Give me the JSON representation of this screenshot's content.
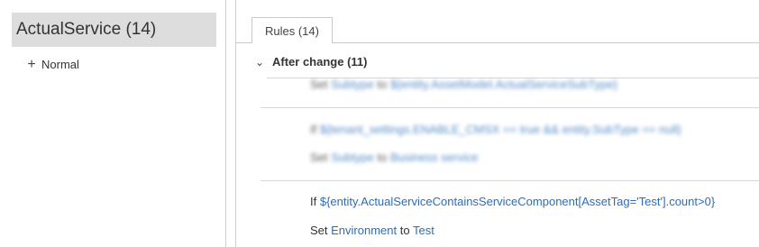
{
  "left": {
    "header_title": "ActualService (14)",
    "tree": [
      {
        "expander": "+",
        "label": "Normal"
      }
    ]
  },
  "right": {
    "tab_label": "Rules (14)",
    "section": {
      "chevron": "⌄",
      "title": "After change (11)"
    },
    "rules": [
      {
        "blurred": true,
        "lines": [
          {
            "keyword": "Set",
            "field": "Subtype",
            "connector": "to",
            "value": "${entity.AssetModel.ActualServiceSubType}"
          }
        ]
      },
      {
        "blurred": true,
        "lines": [
          {
            "keyword": "If",
            "expression": "${tenant_settings.ENABLE_CMSX == true && entity.SubType == null}"
          },
          {
            "keyword": "Set",
            "field": "Subtype",
            "connector": "to",
            "value": "Business service"
          }
        ]
      },
      {
        "blurred": false,
        "lines": [
          {
            "keyword": "If",
            "expression": "${entity.ActualServiceContainsServiceComponent[AssetTag='Test'].count>0}"
          },
          {
            "keyword": "Set",
            "field": "Environment",
            "connector": "to",
            "value": "Test"
          }
        ]
      }
    ]
  },
  "colors": {
    "link": "#2a6ebb",
    "header_bg": "#dddddd",
    "border": "#d0d0d0"
  }
}
